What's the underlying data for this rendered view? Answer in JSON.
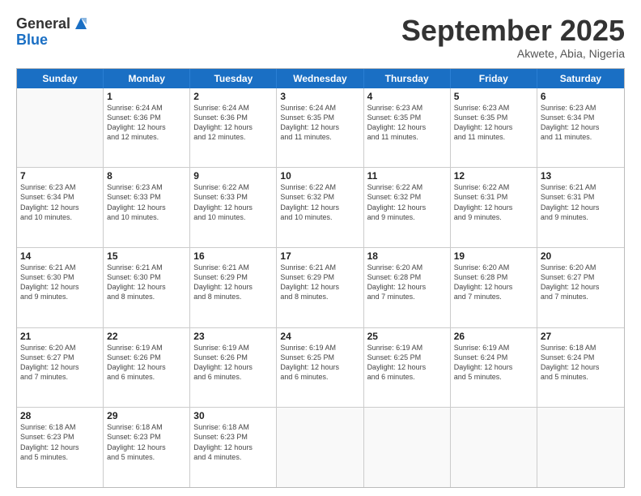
{
  "logo": {
    "general": "General",
    "blue": "Blue"
  },
  "title": "September 2025",
  "location": "Akwete, Abia, Nigeria",
  "days_of_week": [
    "Sunday",
    "Monday",
    "Tuesday",
    "Wednesday",
    "Thursday",
    "Friday",
    "Saturday"
  ],
  "weeks": [
    [
      {
        "day": "",
        "info": ""
      },
      {
        "day": "1",
        "info": "Sunrise: 6:24 AM\nSunset: 6:36 PM\nDaylight: 12 hours\nand 12 minutes."
      },
      {
        "day": "2",
        "info": "Sunrise: 6:24 AM\nSunset: 6:36 PM\nDaylight: 12 hours\nand 12 minutes."
      },
      {
        "day": "3",
        "info": "Sunrise: 6:24 AM\nSunset: 6:35 PM\nDaylight: 12 hours\nand 11 minutes."
      },
      {
        "day": "4",
        "info": "Sunrise: 6:23 AM\nSunset: 6:35 PM\nDaylight: 12 hours\nand 11 minutes."
      },
      {
        "day": "5",
        "info": "Sunrise: 6:23 AM\nSunset: 6:35 PM\nDaylight: 12 hours\nand 11 minutes."
      },
      {
        "day": "6",
        "info": "Sunrise: 6:23 AM\nSunset: 6:34 PM\nDaylight: 12 hours\nand 11 minutes."
      }
    ],
    [
      {
        "day": "7",
        "info": "Sunrise: 6:23 AM\nSunset: 6:34 PM\nDaylight: 12 hours\nand 10 minutes."
      },
      {
        "day": "8",
        "info": "Sunrise: 6:23 AM\nSunset: 6:33 PM\nDaylight: 12 hours\nand 10 minutes."
      },
      {
        "day": "9",
        "info": "Sunrise: 6:22 AM\nSunset: 6:33 PM\nDaylight: 12 hours\nand 10 minutes."
      },
      {
        "day": "10",
        "info": "Sunrise: 6:22 AM\nSunset: 6:32 PM\nDaylight: 12 hours\nand 10 minutes."
      },
      {
        "day": "11",
        "info": "Sunrise: 6:22 AM\nSunset: 6:32 PM\nDaylight: 12 hours\nand 9 minutes."
      },
      {
        "day": "12",
        "info": "Sunrise: 6:22 AM\nSunset: 6:31 PM\nDaylight: 12 hours\nand 9 minutes."
      },
      {
        "day": "13",
        "info": "Sunrise: 6:21 AM\nSunset: 6:31 PM\nDaylight: 12 hours\nand 9 minutes."
      }
    ],
    [
      {
        "day": "14",
        "info": "Sunrise: 6:21 AM\nSunset: 6:30 PM\nDaylight: 12 hours\nand 9 minutes."
      },
      {
        "day": "15",
        "info": "Sunrise: 6:21 AM\nSunset: 6:30 PM\nDaylight: 12 hours\nand 8 minutes."
      },
      {
        "day": "16",
        "info": "Sunrise: 6:21 AM\nSunset: 6:29 PM\nDaylight: 12 hours\nand 8 minutes."
      },
      {
        "day": "17",
        "info": "Sunrise: 6:21 AM\nSunset: 6:29 PM\nDaylight: 12 hours\nand 8 minutes."
      },
      {
        "day": "18",
        "info": "Sunrise: 6:20 AM\nSunset: 6:28 PM\nDaylight: 12 hours\nand 7 minutes."
      },
      {
        "day": "19",
        "info": "Sunrise: 6:20 AM\nSunset: 6:28 PM\nDaylight: 12 hours\nand 7 minutes."
      },
      {
        "day": "20",
        "info": "Sunrise: 6:20 AM\nSunset: 6:27 PM\nDaylight: 12 hours\nand 7 minutes."
      }
    ],
    [
      {
        "day": "21",
        "info": "Sunrise: 6:20 AM\nSunset: 6:27 PM\nDaylight: 12 hours\nand 7 minutes."
      },
      {
        "day": "22",
        "info": "Sunrise: 6:19 AM\nSunset: 6:26 PM\nDaylight: 12 hours\nand 6 minutes."
      },
      {
        "day": "23",
        "info": "Sunrise: 6:19 AM\nSunset: 6:26 PM\nDaylight: 12 hours\nand 6 minutes."
      },
      {
        "day": "24",
        "info": "Sunrise: 6:19 AM\nSunset: 6:25 PM\nDaylight: 12 hours\nand 6 minutes."
      },
      {
        "day": "25",
        "info": "Sunrise: 6:19 AM\nSunset: 6:25 PM\nDaylight: 12 hours\nand 6 minutes."
      },
      {
        "day": "26",
        "info": "Sunrise: 6:19 AM\nSunset: 6:24 PM\nDaylight: 12 hours\nand 5 minutes."
      },
      {
        "day": "27",
        "info": "Sunrise: 6:18 AM\nSunset: 6:24 PM\nDaylight: 12 hours\nand 5 minutes."
      }
    ],
    [
      {
        "day": "28",
        "info": "Sunrise: 6:18 AM\nSunset: 6:23 PM\nDaylight: 12 hours\nand 5 minutes."
      },
      {
        "day": "29",
        "info": "Sunrise: 6:18 AM\nSunset: 6:23 PM\nDaylight: 12 hours\nand 5 minutes."
      },
      {
        "day": "30",
        "info": "Sunrise: 6:18 AM\nSunset: 6:23 PM\nDaylight: 12 hours\nand 4 minutes."
      },
      {
        "day": "",
        "info": ""
      },
      {
        "day": "",
        "info": ""
      },
      {
        "day": "",
        "info": ""
      },
      {
        "day": "",
        "info": ""
      }
    ]
  ]
}
